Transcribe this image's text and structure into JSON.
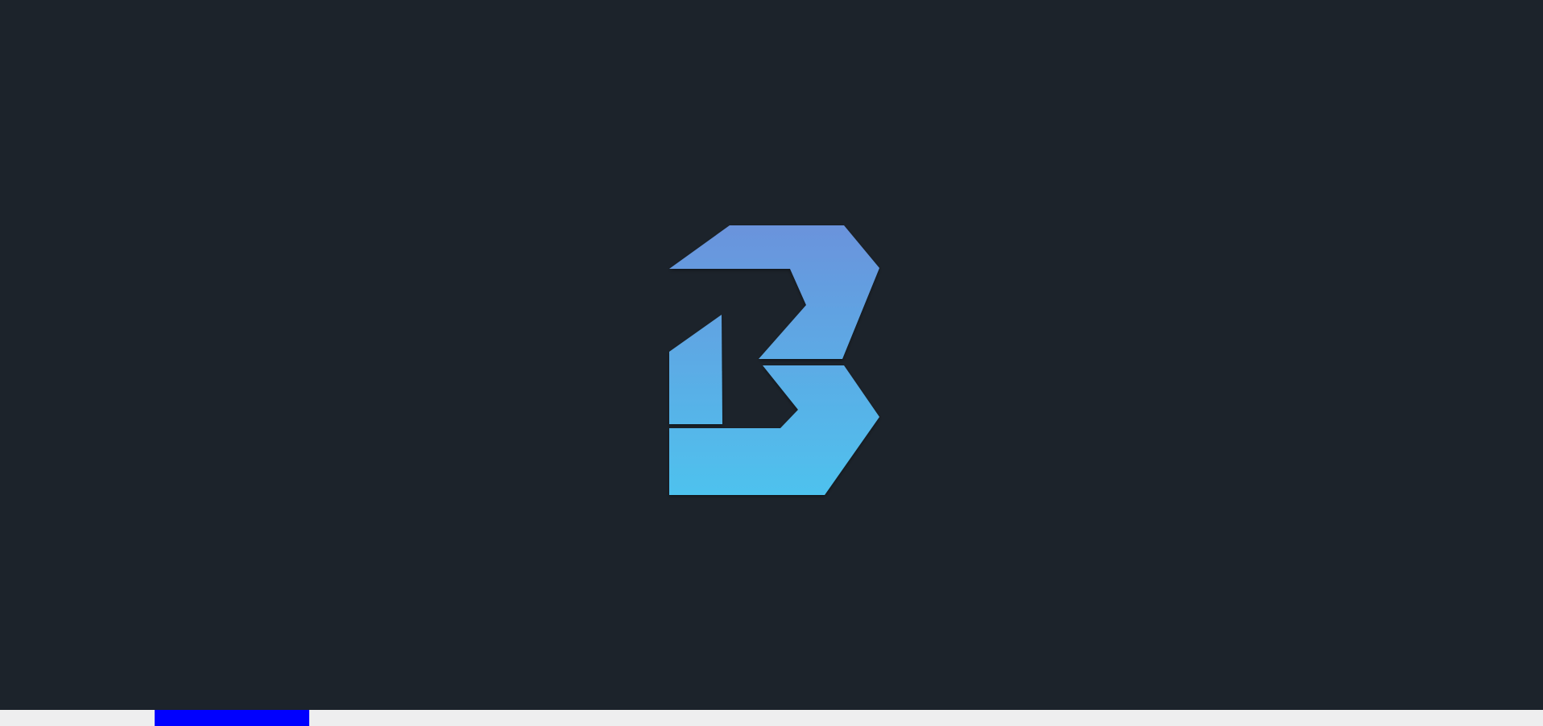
{
  "splash": {
    "background": "#1c232b",
    "logo": {
      "icon": "b-logo-icon",
      "gradient_top": "#6a93dc",
      "gradient_bottom": "#4ec2ee"
    }
  },
  "loading_bar": {
    "track_color": "#eeeeef",
    "fill_color": "#0000ff",
    "indicator_start_fraction": 0.1,
    "indicator_end_fraction": 0.2
  }
}
